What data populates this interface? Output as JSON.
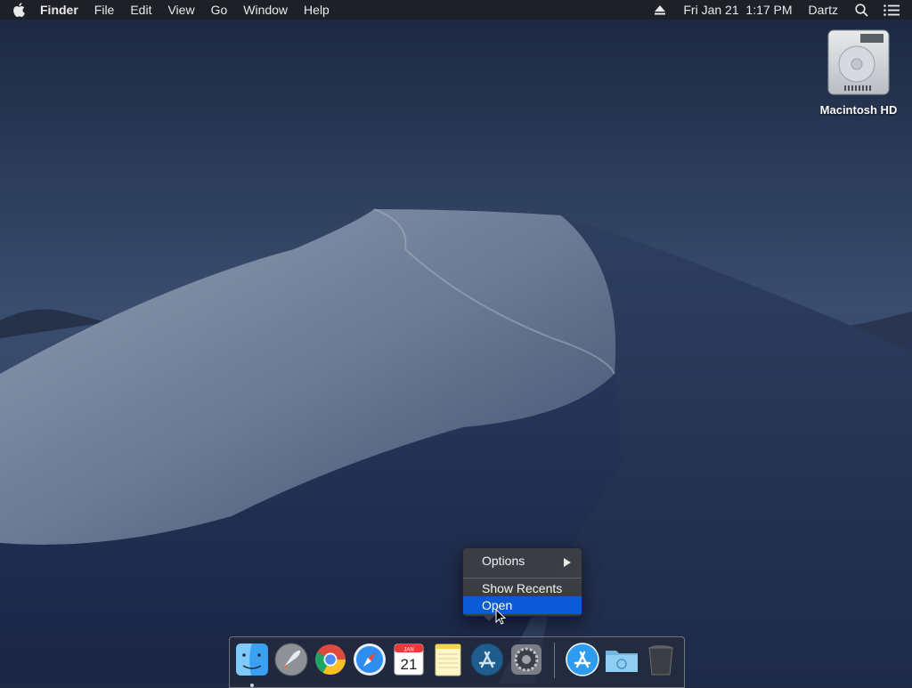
{
  "menubar": {
    "app_name": "Finder",
    "menus": [
      "File",
      "Edit",
      "View",
      "Go",
      "Window",
      "Help"
    ],
    "clock": "Fri Jan 21  1:17 PM",
    "user": "Dartz",
    "icons": [
      "apple-logo",
      "eject-icon",
      "search-icon",
      "list-icon"
    ]
  },
  "desktop": {
    "icon_label": "Macintosh HD"
  },
  "context_menu": {
    "items": [
      "Options",
      "Show Recents",
      "Open"
    ],
    "highlighted": "Open",
    "highlight_color": "#0b5ad6"
  },
  "dock": {
    "apps": [
      "Finder",
      "Launchpad",
      "Google Chrome",
      "Safari",
      "Calendar",
      "Notes",
      "App Store",
      "System Preferences",
      "App Store",
      "Downloads",
      "Trash"
    ],
    "calendar_month": "JAN",
    "calendar_day": "21"
  }
}
